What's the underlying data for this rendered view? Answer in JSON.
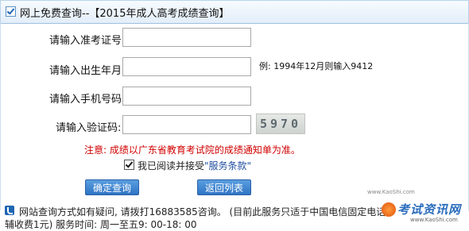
{
  "header": {
    "title_part1": "网上免费查询--",
    "title_part2": "【2015年成人高考成绩查询】"
  },
  "form": {
    "exam_id_label": "请输入准考证号:",
    "birth_label": "请输入出生年月:",
    "birth_example": "例: 1994年12月则输入9412",
    "phone_label": "请输入手机号码:",
    "captcha_label": "请输入验证码:",
    "captcha_value": "5970"
  },
  "notice": "注意: 成绩以广东省教育考试院的成绩通知单为准。",
  "agree": {
    "text": "我已阅读并接受",
    "terms": "\"服务条款\""
  },
  "buttons": {
    "submit": "确定查询",
    "back": "返回列表"
  },
  "footer": {
    "line1": "网站查询方式如有疑问, 请拨打16883585咨询。 (目前此服务只适于中国电信固定电话",
    "line2": "辅收费1元) 服务时间: 周一至五9: 00-18: 00"
  },
  "watermark": {
    "url_top": "www.KaoShi.com",
    "brand": "考试资讯网",
    "url": "www.KaoShi.com"
  },
  "colors": {
    "accent": "#2f74c4",
    "notice": "#d00000",
    "terms_link": "#1f4d9e"
  }
}
